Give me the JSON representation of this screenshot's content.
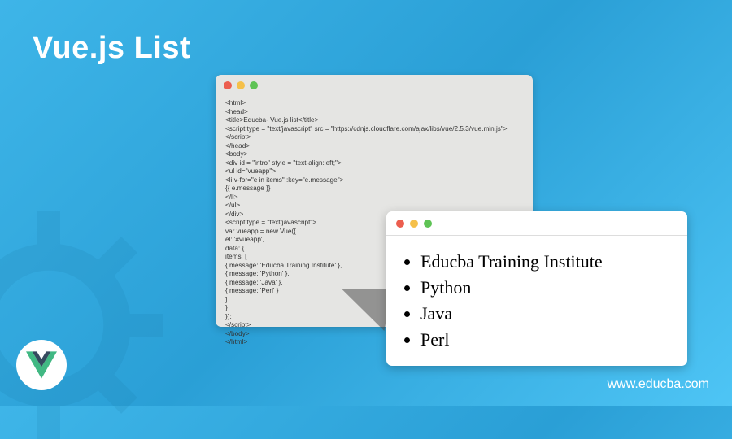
{
  "title": "Vue.js List",
  "url": "www.educba.com",
  "code": {
    "lines": [
      "<html>",
      "<head>",
      "<title>Educba- Vue.js list</title>",
      "<script type = \"text/javascript\" src = \"https://cdnjs.cloudflare.com/ajax/libs/vue/2.5.3/vue.min.js\">",
      "</script>",
      "</head>",
      "<body>",
      "<div id = \"intro\" style = \"text-align:left;\">",
      "<ul id=\"vueapp\">",
      "<li v-for=\"e in items\" :key=\"e.message\">",
      "{{ e.message }}",
      "</li>",
      "</ul>",
      "</div>",
      "<script type = \"text/javascript\">",
      "var vueapp = new Vue({",
      "el: '#vueapp',",
      "data: {",
      "items: [",
      "{ message: 'Educba Training Institute' },",
      "{ message: 'Python' },",
      "{ message: 'Java' },",
      "{ message: 'Perl' }",
      "]",
      "}",
      "});",
      "</script>",
      "</body>",
      "</html>"
    ]
  },
  "output": {
    "items": [
      "Educba Training Institute",
      "Python",
      "Java",
      "Perl"
    ]
  },
  "icons": {
    "vue_outer": "#41b883",
    "vue_inner": "#35495e"
  }
}
